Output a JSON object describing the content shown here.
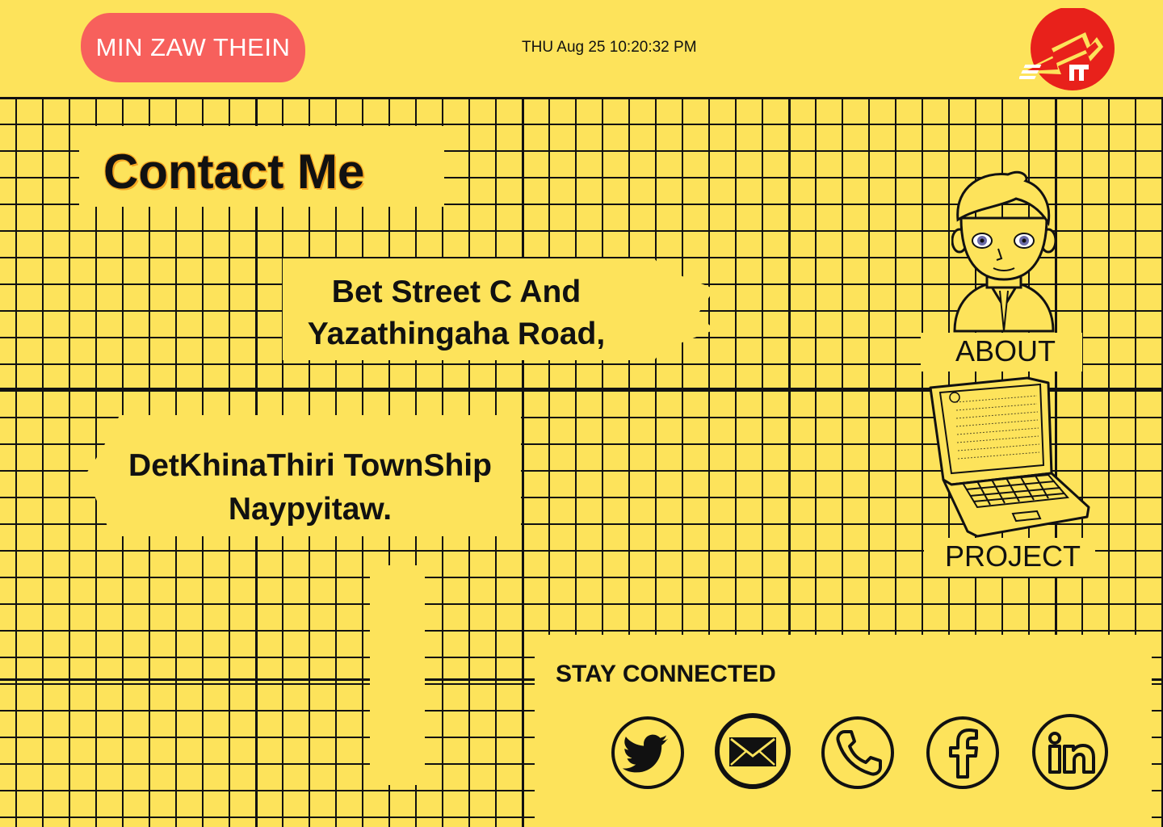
{
  "header": {
    "name": "MIN ZAW THEIN",
    "datetime": "THU Aug 25 10:20:32 PM",
    "logo_icon": "mountain-logo-icon"
  },
  "contact": {
    "title": "Contact Me",
    "address_line1": "Bet Street C And",
    "address_line2": "Yazathingaha Road,",
    "address_line3": "DetKhinaThiri TownShip",
    "address_line4": "Naypyitaw."
  },
  "nav": {
    "about_label": "ABOUT",
    "project_label": "PROJECT"
  },
  "social": {
    "title": "STAY CONNECTED",
    "icons": [
      "twitter-icon",
      "mail-icon",
      "phone-icon",
      "facebook-icon",
      "linkedin-icon"
    ]
  },
  "colors": {
    "background": "#fde35b",
    "badge": "#f7605c",
    "logo": "#e8211b",
    "title_outline": "#f5a623",
    "ink": "#111111"
  }
}
